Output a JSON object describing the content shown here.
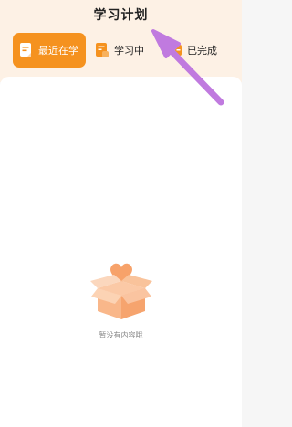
{
  "header": {
    "title": "学习计划"
  },
  "tabs": [
    {
      "label": "最近在学",
      "active": true,
      "icon": "document-icon"
    },
    {
      "label": "学习中",
      "active": false,
      "icon": "notebook-icon"
    },
    {
      "label": "已完成",
      "active": false,
      "icon": "checklist-icon"
    }
  ],
  "empty_state": {
    "message": "暂没有内容哦",
    "icon": "empty-box-heart-icon"
  },
  "colors": {
    "accent": "#f5921f",
    "header_bg": "#fdf1e5",
    "annotation_arrow": "#c07adf"
  }
}
